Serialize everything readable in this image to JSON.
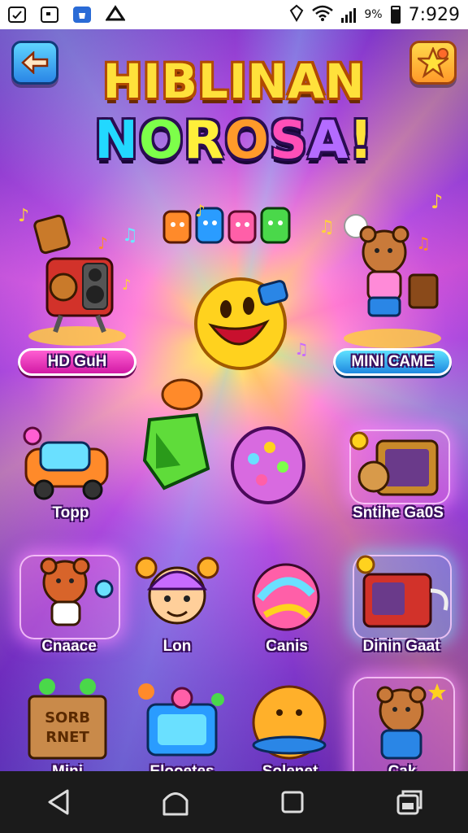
{
  "status_bar": {
    "time": "7:929",
    "battery_text": "%",
    "battery_suffix": "9",
    "icons": [
      "photo-icon",
      "message-icon",
      "store-icon",
      "app-icon",
      "nfc-icon",
      "wifi-icon",
      "signal-icon",
      "battery-icon"
    ]
  },
  "header": {
    "title_line1": "HIBLINAN",
    "title_line2_letters": [
      "N",
      "O",
      "R",
      "O",
      "S",
      "A",
      "!"
    ],
    "title_line2_colors": [
      "#22d8ff",
      "#7dff4a",
      "#ffef3a",
      "#ff9a2a",
      "#ff4fb8",
      "#b46bff",
      "#ffe13b"
    ],
    "back_button": "back-arrow-icon",
    "star_button": "star-icon"
  },
  "tiles": [
    {
      "label": "HD GuH",
      "style": "pill-pink",
      "icon": "robot-speaker-icon"
    },
    {
      "label": "MINI CAME",
      "style": "pill-blue",
      "icon": "bear-dancer-icon"
    },
    {
      "label": "Topp",
      "style": "plain",
      "icon": "rainbow-car-icon"
    },
    {
      "label": "Sntihe Ga0S",
      "style": "plain",
      "icon": "treasure-chest-icon"
    },
    {
      "label": "Cnaace",
      "style": "plain",
      "icon": "bear-runner-icon"
    },
    {
      "label": "Lon",
      "style": "plain",
      "icon": "kid-face-icon"
    },
    {
      "label": "Canis",
      "style": "plain",
      "icon": "swirl-ball-icon"
    },
    {
      "label": "Dinin Gaat",
      "style": "plain",
      "icon": "gift-machine-icon"
    },
    {
      "label": "Mini",
      "style": "plain",
      "icon": "wooden-crate-icon"
    },
    {
      "label": "Elooetes",
      "style": "plain",
      "icon": "blue-console-icon"
    },
    {
      "label": "Solenet",
      "style": "plain",
      "icon": "orange-ball-icon"
    },
    {
      "label": "Cak",
      "style": "plain",
      "icon": "bear-sparkle-icon"
    }
  ],
  "crate_text": [
    "SORB",
    "RNET"
  ],
  "center": {
    "mascot": "smiley-mascot-icon",
    "gem": "green-gem-icon",
    "disc": "pink-disc-icon"
  },
  "nav_bar": [
    "back-nav-icon",
    "home-nav-icon",
    "recents-nav-icon",
    "switch-nav-icon"
  ],
  "colors": {
    "accent_pink": "#ff5fd2",
    "accent_blue": "#1f88e0",
    "title_yellow": "#ffe13b",
    "bg_purple": "#7e36c9"
  }
}
